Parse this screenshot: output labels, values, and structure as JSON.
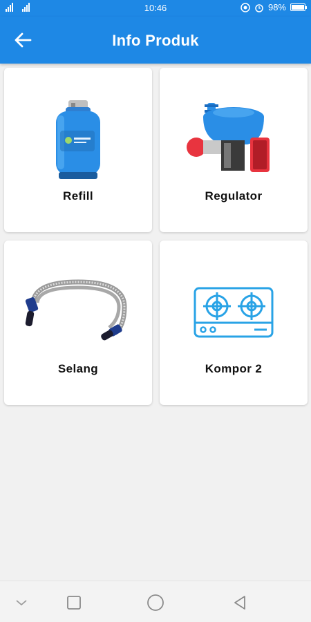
{
  "status_bar": {
    "time": "10:46",
    "battery": "98%",
    "battery_level": 0.98
  },
  "app_bar": {
    "title": "Info Produk",
    "back_icon": "arrow-left-icon"
  },
  "products": [
    {
      "label": "Refill",
      "icon": "gas-cylinder-image"
    },
    {
      "label": "Regulator",
      "icon": "gas-regulator-image"
    },
    {
      "label": "Selang",
      "icon": "gas-hose-image"
    },
    {
      "label": "Kompor 2",
      "icon": "stove-icon"
    }
  ],
  "nav_bar": {
    "buttons": [
      "chevron-down-icon",
      "recents-square-icon",
      "home-circle-icon",
      "back-triangle-icon"
    ]
  },
  "colors": {
    "primary": "#1e88e5",
    "stove_blue": "#29a3e6"
  }
}
